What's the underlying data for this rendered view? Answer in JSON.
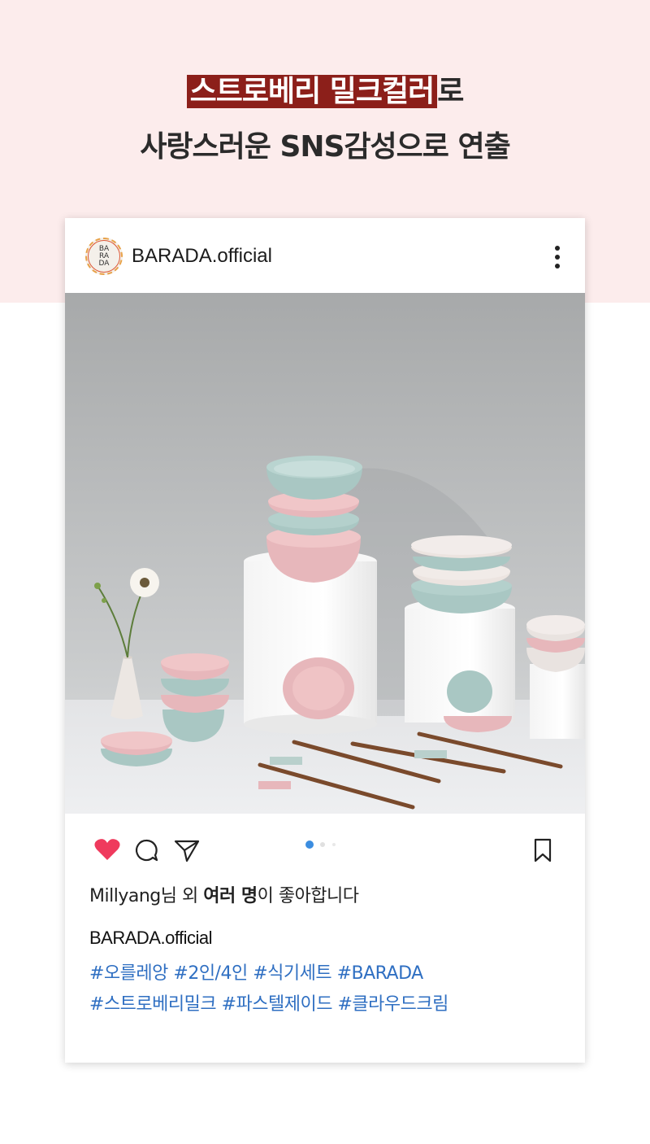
{
  "headline": {
    "highlight": "스트로베리 밀크컬러",
    "line1_suffix": "로",
    "line2": "사랑스러운 SNS감성으로 연출"
  },
  "post": {
    "account_name": "BARADA.official",
    "avatar_text": "BA RA DA",
    "likes": {
      "user": "Millyang",
      "suffix_1": "님 외 ",
      "bold": "여러 명",
      "suffix_2": "이 좋아합니다"
    },
    "caption": {
      "account": "BARADA.official",
      "tags_line1": "#오를레앙 #2인/4인 #식기세트 #BARADA",
      "tags_line2": "#스트로베리밀크 #파스텔제이드 #클라우드크림"
    },
    "carousel": {
      "count": 3,
      "active": 1
    }
  },
  "colors": {
    "highlight_bg": "#8c1f1a",
    "top_band": "#fcecec",
    "heart": "#ef3a5d",
    "hashtag": "#2f6fc2",
    "dot_active": "#3b8de0"
  },
  "icons": [
    "heart-icon",
    "comment-icon",
    "share-icon",
    "bookmark-icon",
    "more-icon"
  ]
}
